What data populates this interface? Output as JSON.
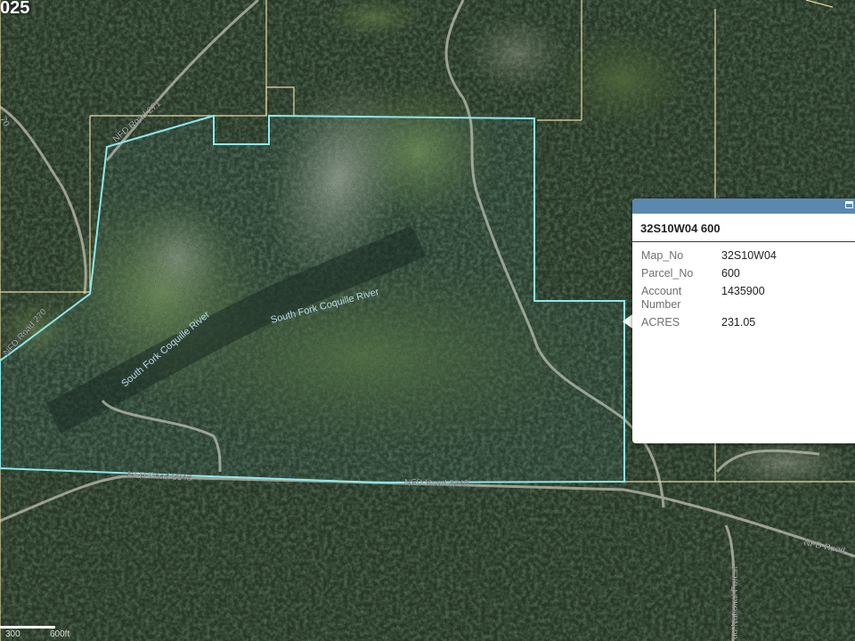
{
  "corner_label": "025",
  "map": {
    "road_labels": {
      "nfd_271": "NFD Road 271",
      "nfd_270_upper": "70",
      "nfd_270": "NFD Road 270",
      "nfd_3348_left": "NFD Road 3348",
      "nfd_3348_mid": "NFD Road 3348",
      "nfd_right": "NFD Road",
      "forest": "ou National Forest"
    },
    "river_labels": {
      "river_left": "South Fork Coquille River",
      "river_mid": "South Fork Coquille River"
    },
    "colors": {
      "parcel_outline": "#8ee8ee",
      "tax_lot_lines": "#e8d8a0",
      "road": "#b8b8a8"
    }
  },
  "popup": {
    "title": "32S10W04 600",
    "fields": [
      {
        "key": "Map_No",
        "value": "32S10W04"
      },
      {
        "key": "Parcel_No",
        "value": "600"
      },
      {
        "key": "Account Number",
        "value": "1435900"
      },
      {
        "key": "ACRES",
        "value": "231.05"
      }
    ],
    "header_color": "#5b88ad"
  },
  "scale": {
    "label_left": "300",
    "label_right": "600ft"
  }
}
